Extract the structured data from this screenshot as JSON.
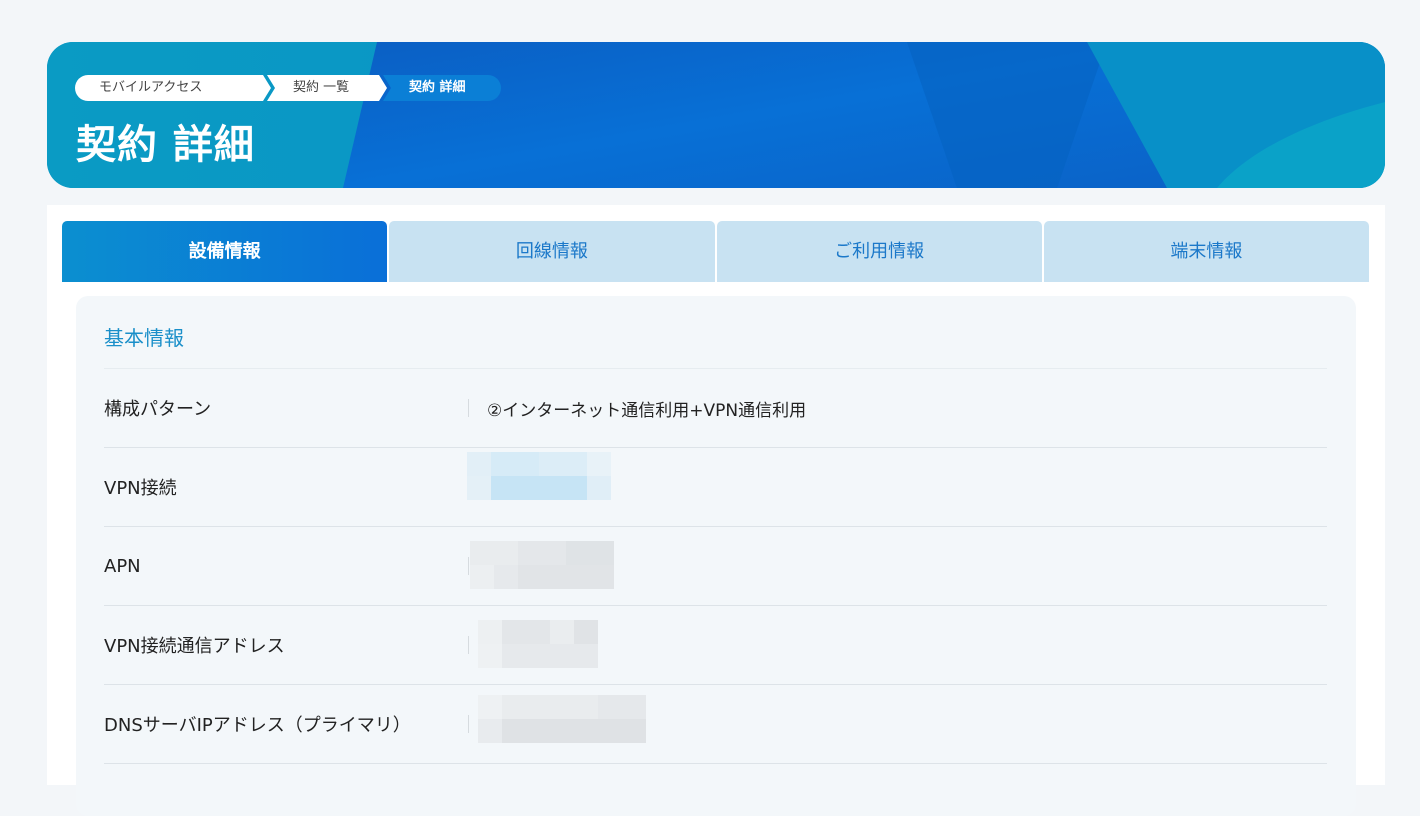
{
  "breadcrumb": {
    "items": [
      "モバイルアクセス",
      "契約 一覧",
      "契約 詳細"
    ]
  },
  "page_title": "契約 詳細",
  "tabs": [
    "設備情報",
    "回線情報",
    "ご利用情報",
    "端末情報"
  ],
  "active_tab": "設備情報",
  "section_title": "基本情報",
  "rows": [
    {
      "label": "構成パターン",
      "value": "②インターネット通信利用+VPN通信利用",
      "redacted": false
    },
    {
      "label": "VPN接続",
      "value": "",
      "redacted": true
    },
    {
      "label": "APN",
      "value": "",
      "redacted": true
    },
    {
      "label": "VPN接続通信アドレス",
      "value": "",
      "redacted": true
    },
    {
      "label": "DNSサーバIPアドレス（プライマリ）",
      "value": "",
      "redacted": true
    }
  ],
  "colors": {
    "accent": "#1a8fc9",
    "tab_active": "#0b7fd6",
    "tab_inactive": "#c8e2f2",
    "hero": "#0a8fc2"
  }
}
